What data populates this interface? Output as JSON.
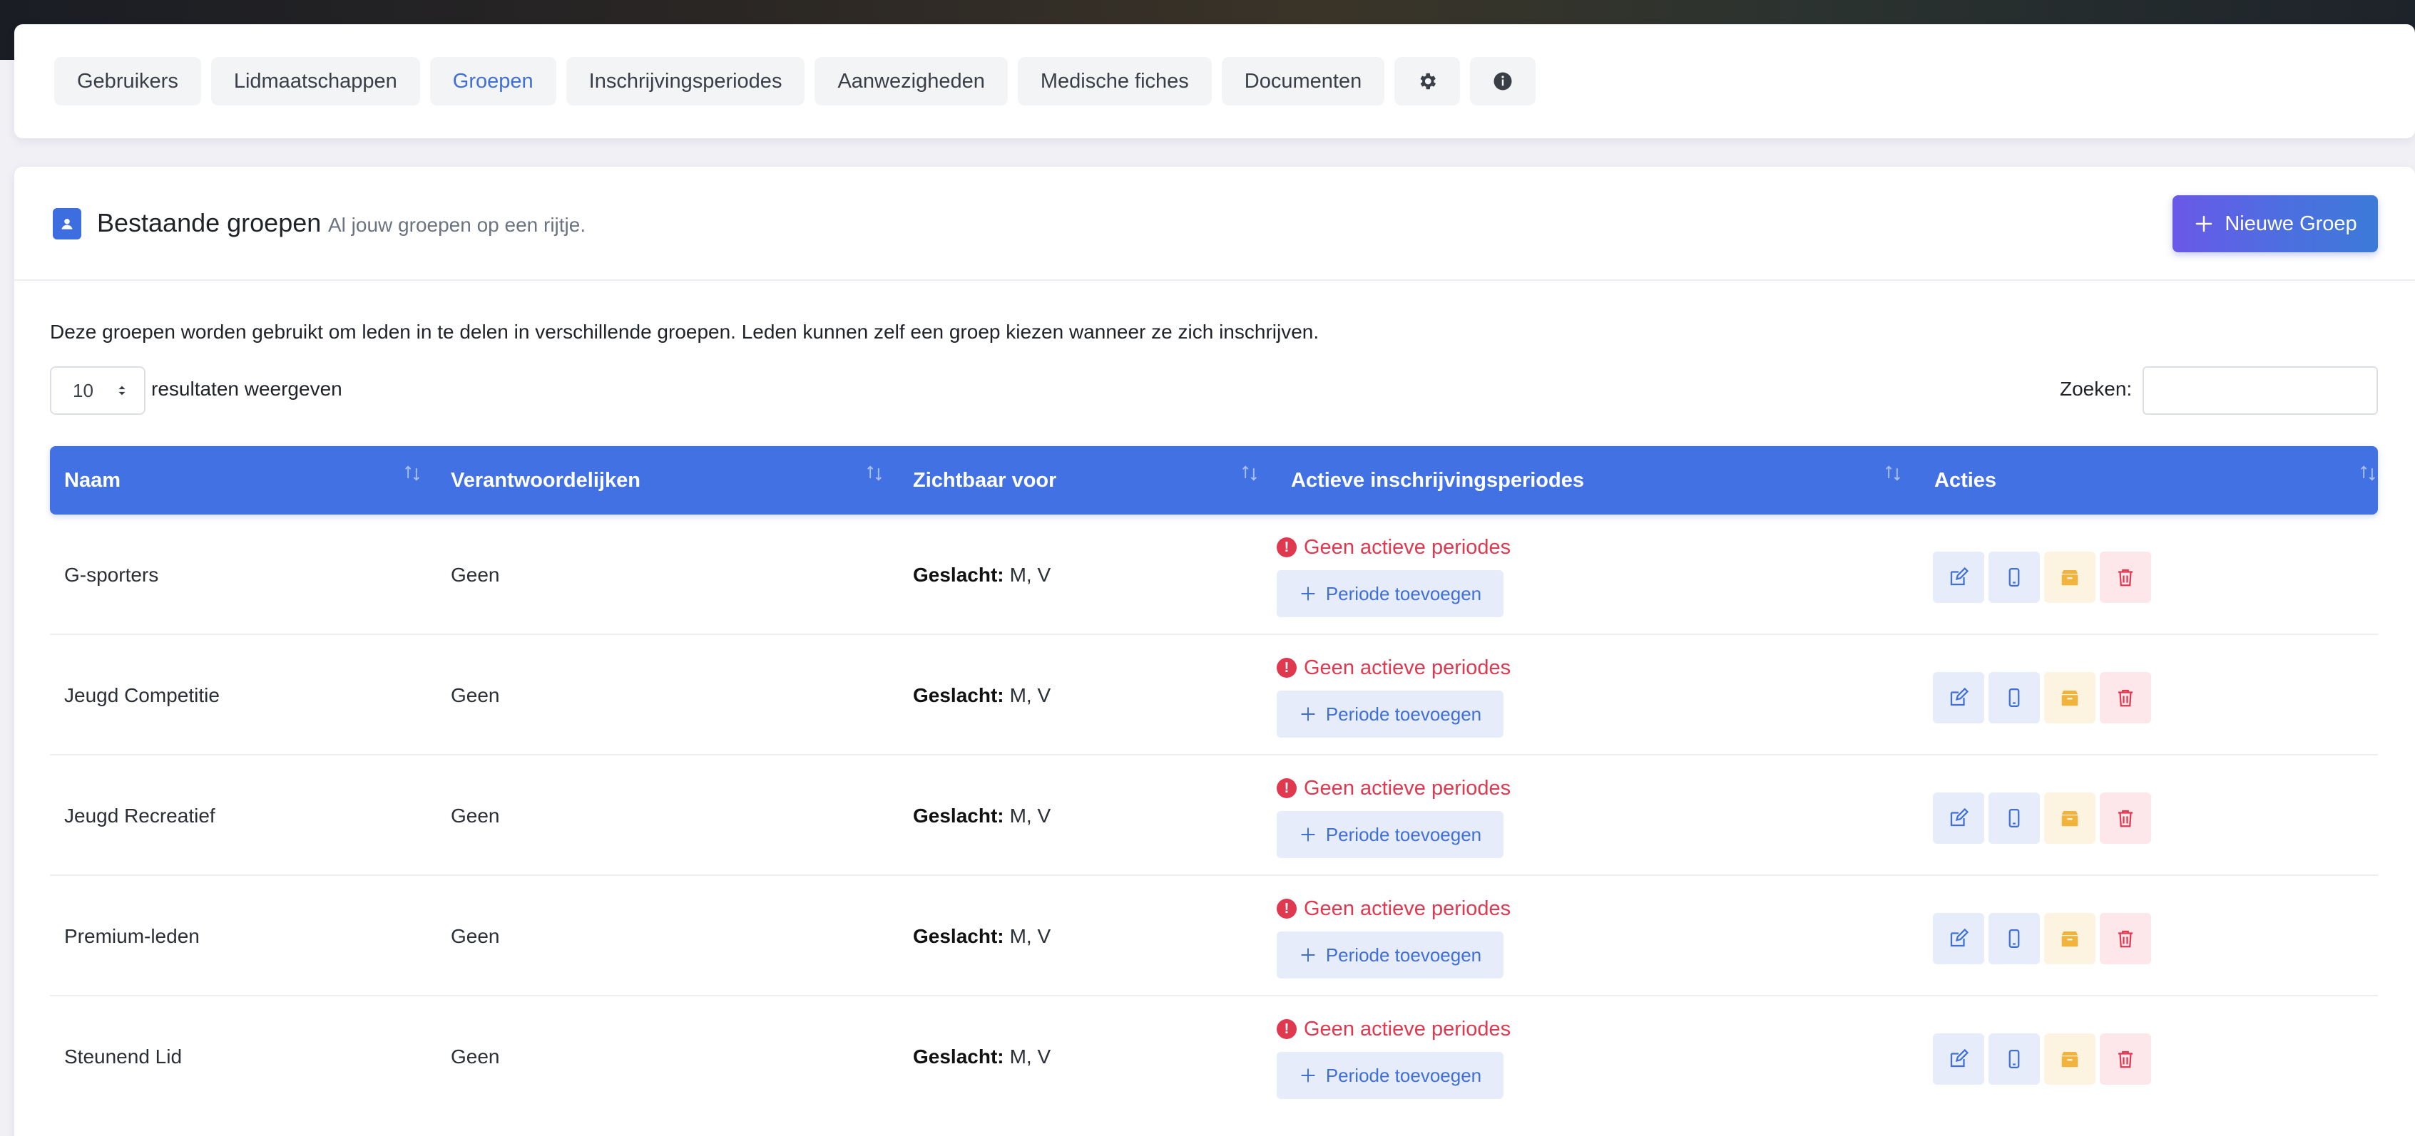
{
  "nav": {
    "tabs": [
      {
        "label": "Gebruikers",
        "active": false
      },
      {
        "label": "Lidmaatschappen",
        "active": false
      },
      {
        "label": "Groepen",
        "active": true
      },
      {
        "label": "Inschrijvingsperiodes",
        "active": false
      },
      {
        "label": "Aanwezigheden",
        "active": false
      },
      {
        "label": "Medische fiches",
        "active": false
      },
      {
        "label": "Documenten",
        "active": false
      }
    ],
    "icon_tabs": [
      "gear-icon",
      "info-icon"
    ]
  },
  "header": {
    "title": "Bestaande groepen",
    "subtitle": "Al jouw groepen op een rijtje.",
    "new_button_label": "Nieuwe Groep",
    "icon": "user-badge-icon"
  },
  "description": "Deze groepen worden gebruikt om leden in te delen in verschillende groepen. Leden kunnen zelf een groep kiezen wanneer ze zich inschrijven.",
  "length_control": {
    "value": "10",
    "label": "resultaten weergeven"
  },
  "search": {
    "label": "Zoeken:",
    "value": ""
  },
  "table": {
    "columns": [
      "Naam",
      "Verantwoordelijken",
      "Zichtbaar voor",
      "Actieve inschrijvingsperiodes",
      "Acties"
    ],
    "visibility_label": "Geslacht:",
    "no_periods_text": "Geen actieve periodes",
    "add_period_label": "Periode toevoegen",
    "rows": [
      {
        "name": "G-sporters",
        "responsible": "Geen",
        "visible_for": "M, V"
      },
      {
        "name": "Jeugd Competitie",
        "responsible": "Geen",
        "visible_for": "M, V"
      },
      {
        "name": "Jeugd Recreatief",
        "responsible": "Geen",
        "visible_for": "M, V"
      },
      {
        "name": "Premium-leden",
        "responsible": "Geen",
        "visible_for": "M, V"
      },
      {
        "name": "Steunend Lid",
        "responsible": "Geen",
        "visible_for": "M, V"
      }
    ]
  },
  "colors": {
    "accent": "#4271e4",
    "danger": "#e0384f",
    "warning": "#f2b33d",
    "active_tab": "#3f6fd8"
  }
}
